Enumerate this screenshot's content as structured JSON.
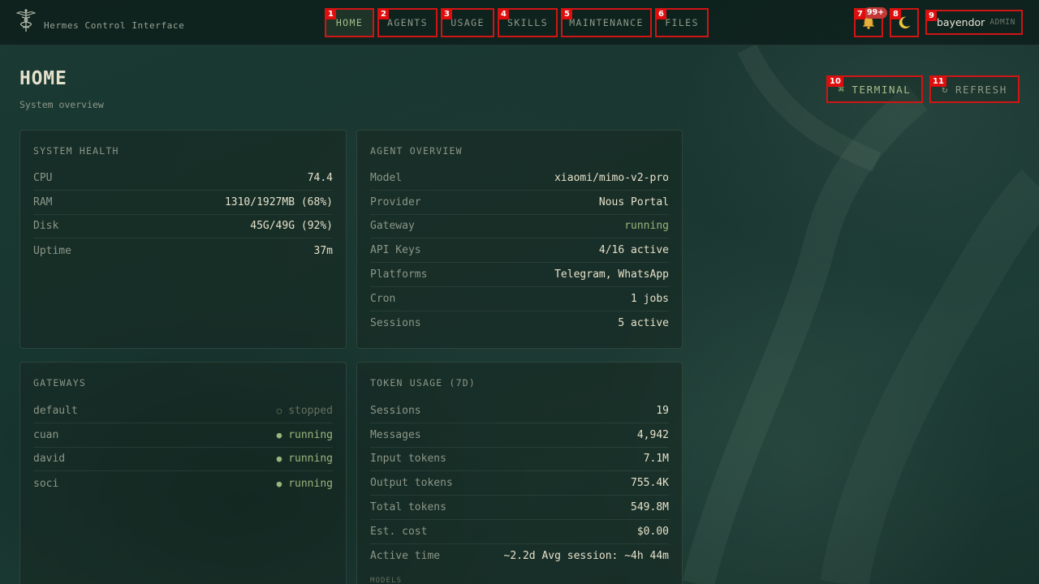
{
  "app": {
    "brand": "Hermes Control Interface"
  },
  "nav": {
    "tabs": [
      {
        "num": "1",
        "label": "HOME"
      },
      {
        "num": "2",
        "label": "AGENTS"
      },
      {
        "num": "3",
        "label": "USAGE"
      },
      {
        "num": "4",
        "label": "SKILLS"
      },
      {
        "num": "5",
        "label": "MAINTENANCE"
      },
      {
        "num": "6",
        "label": "FILES"
      }
    ]
  },
  "header": {
    "notifications": {
      "num": "7",
      "count": "99+",
      "icon": "bell-icon"
    },
    "theme_toggle": {
      "num": "8",
      "icon": "moon-icon"
    },
    "user": {
      "num": "9",
      "name": "bayendor",
      "role": "ADMIN"
    }
  },
  "page": {
    "title": "HOME",
    "subtitle": "System overview"
  },
  "actions": {
    "terminal": {
      "num": "10",
      "glyph": "⌘",
      "label": "TERMINAL"
    },
    "refresh": {
      "num": "11",
      "glyph": "↻",
      "label": "REFRESH"
    }
  },
  "system_health": {
    "title": "SYSTEM HEALTH",
    "rows": [
      {
        "label": "CPU",
        "value": "74.4"
      },
      {
        "label": "RAM",
        "value": "1310/1927MB (68%)"
      },
      {
        "label": "Disk",
        "value": "45G/49G (92%)"
      },
      {
        "label": "Uptime",
        "value": "37m"
      }
    ]
  },
  "agent_overview": {
    "title": "AGENT OVERVIEW",
    "rows": [
      {
        "label": "Model",
        "value": "xiaomi/mimo-v2-pro"
      },
      {
        "label": "Provider",
        "value": "Nous Portal"
      },
      {
        "label": "Gateway",
        "value": "running"
      },
      {
        "label": "API Keys",
        "value": "4/16 active"
      },
      {
        "label": "Platforms",
        "value": "Telegram, WhatsApp"
      },
      {
        "label": "Cron",
        "value": "1 jobs"
      },
      {
        "label": "Sessions",
        "value": "5 active"
      }
    ]
  },
  "gateways": {
    "title": "GATEWAYS",
    "rows": [
      {
        "label": "default",
        "dot": "○",
        "value": "stopped"
      },
      {
        "label": "cuan",
        "dot": "●",
        "value": "running"
      },
      {
        "label": "david",
        "dot": "●",
        "value": "running"
      },
      {
        "label": "soci",
        "dot": "●",
        "value": "running"
      }
    ]
  },
  "token_usage": {
    "title": "TOKEN USAGE (7D)",
    "rows": [
      {
        "label": "Sessions",
        "value": "19"
      },
      {
        "label": "Messages",
        "value": "4,942"
      },
      {
        "label": "Input tokens",
        "value": "7.1M"
      },
      {
        "label": "Output tokens",
        "value": "755.4K"
      },
      {
        "label": "Total tokens",
        "value": "549.8M"
      },
      {
        "label": "Est. cost",
        "value": "$0.00"
      },
      {
        "label": "Active time",
        "value": "~2.2d Avg session: ~4h 44m"
      }
    ],
    "models_label": "MODELS"
  },
  "colors": {
    "accent": "#a7bd8a",
    "running": "#9cb57c",
    "stopped": "#66705f",
    "annotation": "#d01515"
  }
}
